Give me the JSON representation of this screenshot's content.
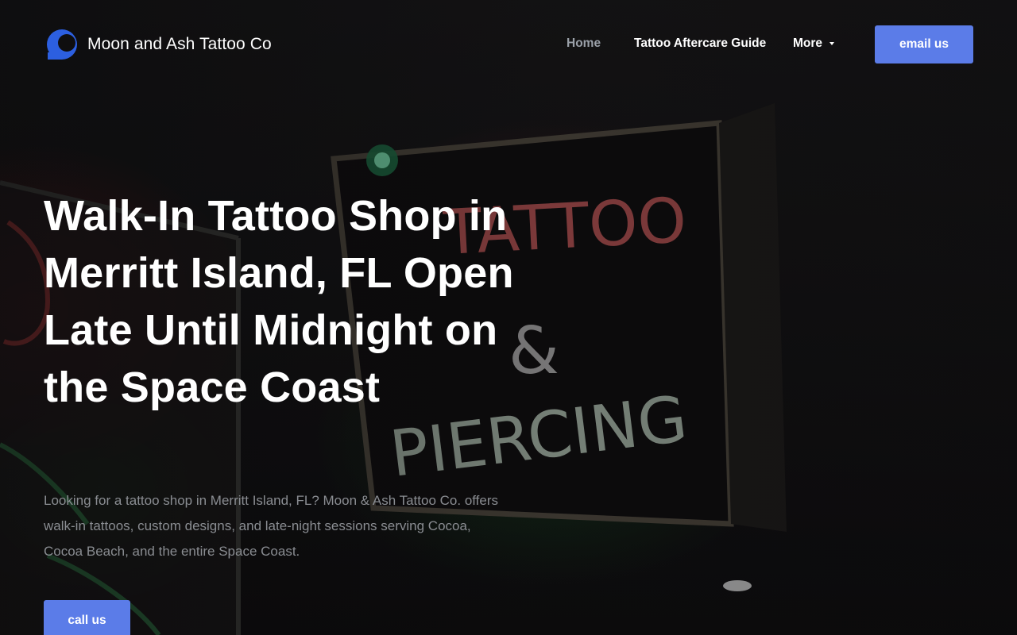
{
  "brand": {
    "name": "Moon and Ash Tattoo Co",
    "logo_icon": "moon-logo-icon",
    "logo_color": "#2c5fe0"
  },
  "nav": {
    "items": [
      {
        "label": "Home",
        "active": true
      },
      {
        "label": "Tattoo Aftercare Guide",
        "active": false
      },
      {
        "label": "More",
        "active": false,
        "dropdown": true
      }
    ],
    "cta_label": "email us"
  },
  "hero": {
    "title": "Walk-In Tattoo Shop in Merritt Island, FL Open Late Until Midnight on the Space Coast",
    "description": "Looking for a tattoo shop in Merritt Island, FL? Moon & Ash Tattoo Co. offers walk-in tattoos, custom designs, and late-night sessions serving Cocoa, Cocoa Beach, and the entire Space Coast.",
    "cta_label": "call us",
    "background_image": "neon tattoo and piercing sign at night"
  },
  "colors": {
    "accent": "#5b7ce8",
    "text": "#ffffff",
    "muted_text": "#8a8d92",
    "nav_active": "#9aa0a8"
  }
}
